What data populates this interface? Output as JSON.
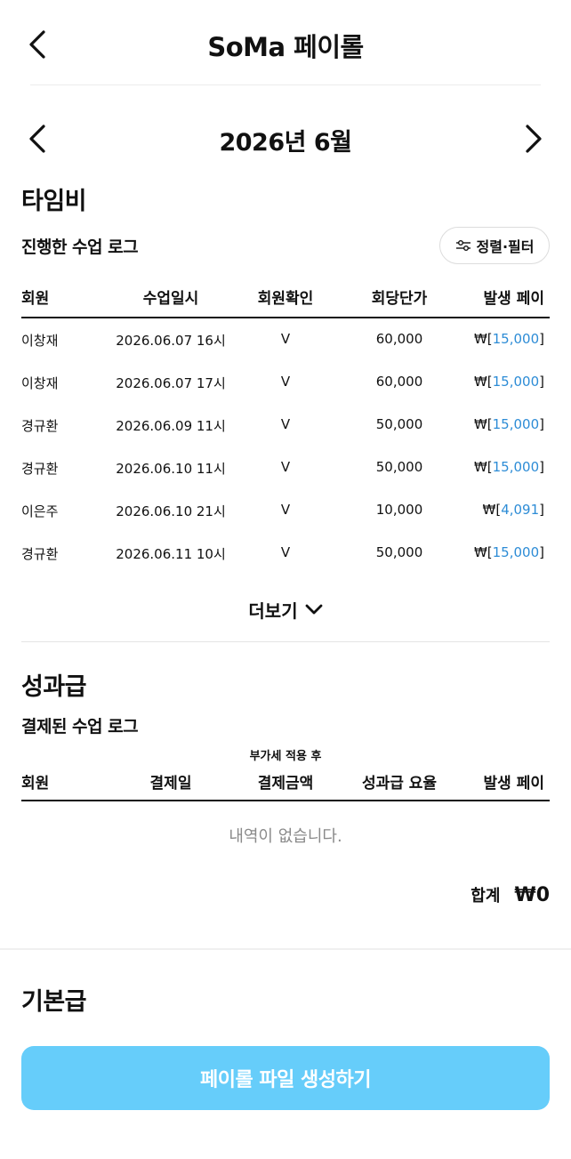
{
  "header": {
    "title": "SoMa 페이롤"
  },
  "month": {
    "label": "2026년 6월"
  },
  "time_pay": {
    "title": "타임비",
    "subtitle": "진행한 수업 로그",
    "filter_label": "정렬·필터",
    "columns": [
      "회원",
      "수업일시",
      "회원확인",
      "회당단가",
      "발생 페이"
    ],
    "rows": [
      {
        "member": "이창재",
        "datetime": "2026.06.07 16시",
        "confirmed": "V",
        "unit_price": "60,000",
        "pay": "15,000"
      },
      {
        "member": "이창재",
        "datetime": "2026.06.07 17시",
        "confirmed": "V",
        "unit_price": "60,000",
        "pay": "15,000"
      },
      {
        "member": "경규환",
        "datetime": "2026.06.09 11시",
        "confirmed": "V",
        "unit_price": "50,000",
        "pay": "15,000"
      },
      {
        "member": "경규환",
        "datetime": "2026.06.10 11시",
        "confirmed": "V",
        "unit_price": "50,000",
        "pay": "15,000"
      },
      {
        "member": "이은주",
        "datetime": "2026.06.10 21시",
        "confirmed": "V",
        "unit_price": "10,000",
        "pay": "4,091"
      },
      {
        "member": "경규환",
        "datetime": "2026.06.11 10시",
        "confirmed": "V",
        "unit_price": "50,000",
        "pay": "15,000"
      }
    ],
    "currency_prefix": "₩[",
    "currency_suffix": "]",
    "more_label": "더보기"
  },
  "bonus": {
    "title": "성과급",
    "subtitle": "결제된 수업 로그",
    "vat_note": "부가세 적용 후",
    "columns": [
      "회원",
      "결제일",
      "결제금액",
      "성과급 요율",
      "발생 페이"
    ],
    "empty_text": "내역이 없습니다.",
    "total_label": "합계",
    "total_value": "₩0"
  },
  "base_pay": {
    "title": "기본급"
  },
  "cta": {
    "label": "페이롤 파일 생성하기"
  },
  "colors": {
    "accent": "#66cdfa",
    "link_blue": "#2d8cd6"
  },
  "icons": [
    "chevron-left-icon",
    "chevron-right-icon",
    "sliders-icon",
    "chevron-down-icon"
  ]
}
